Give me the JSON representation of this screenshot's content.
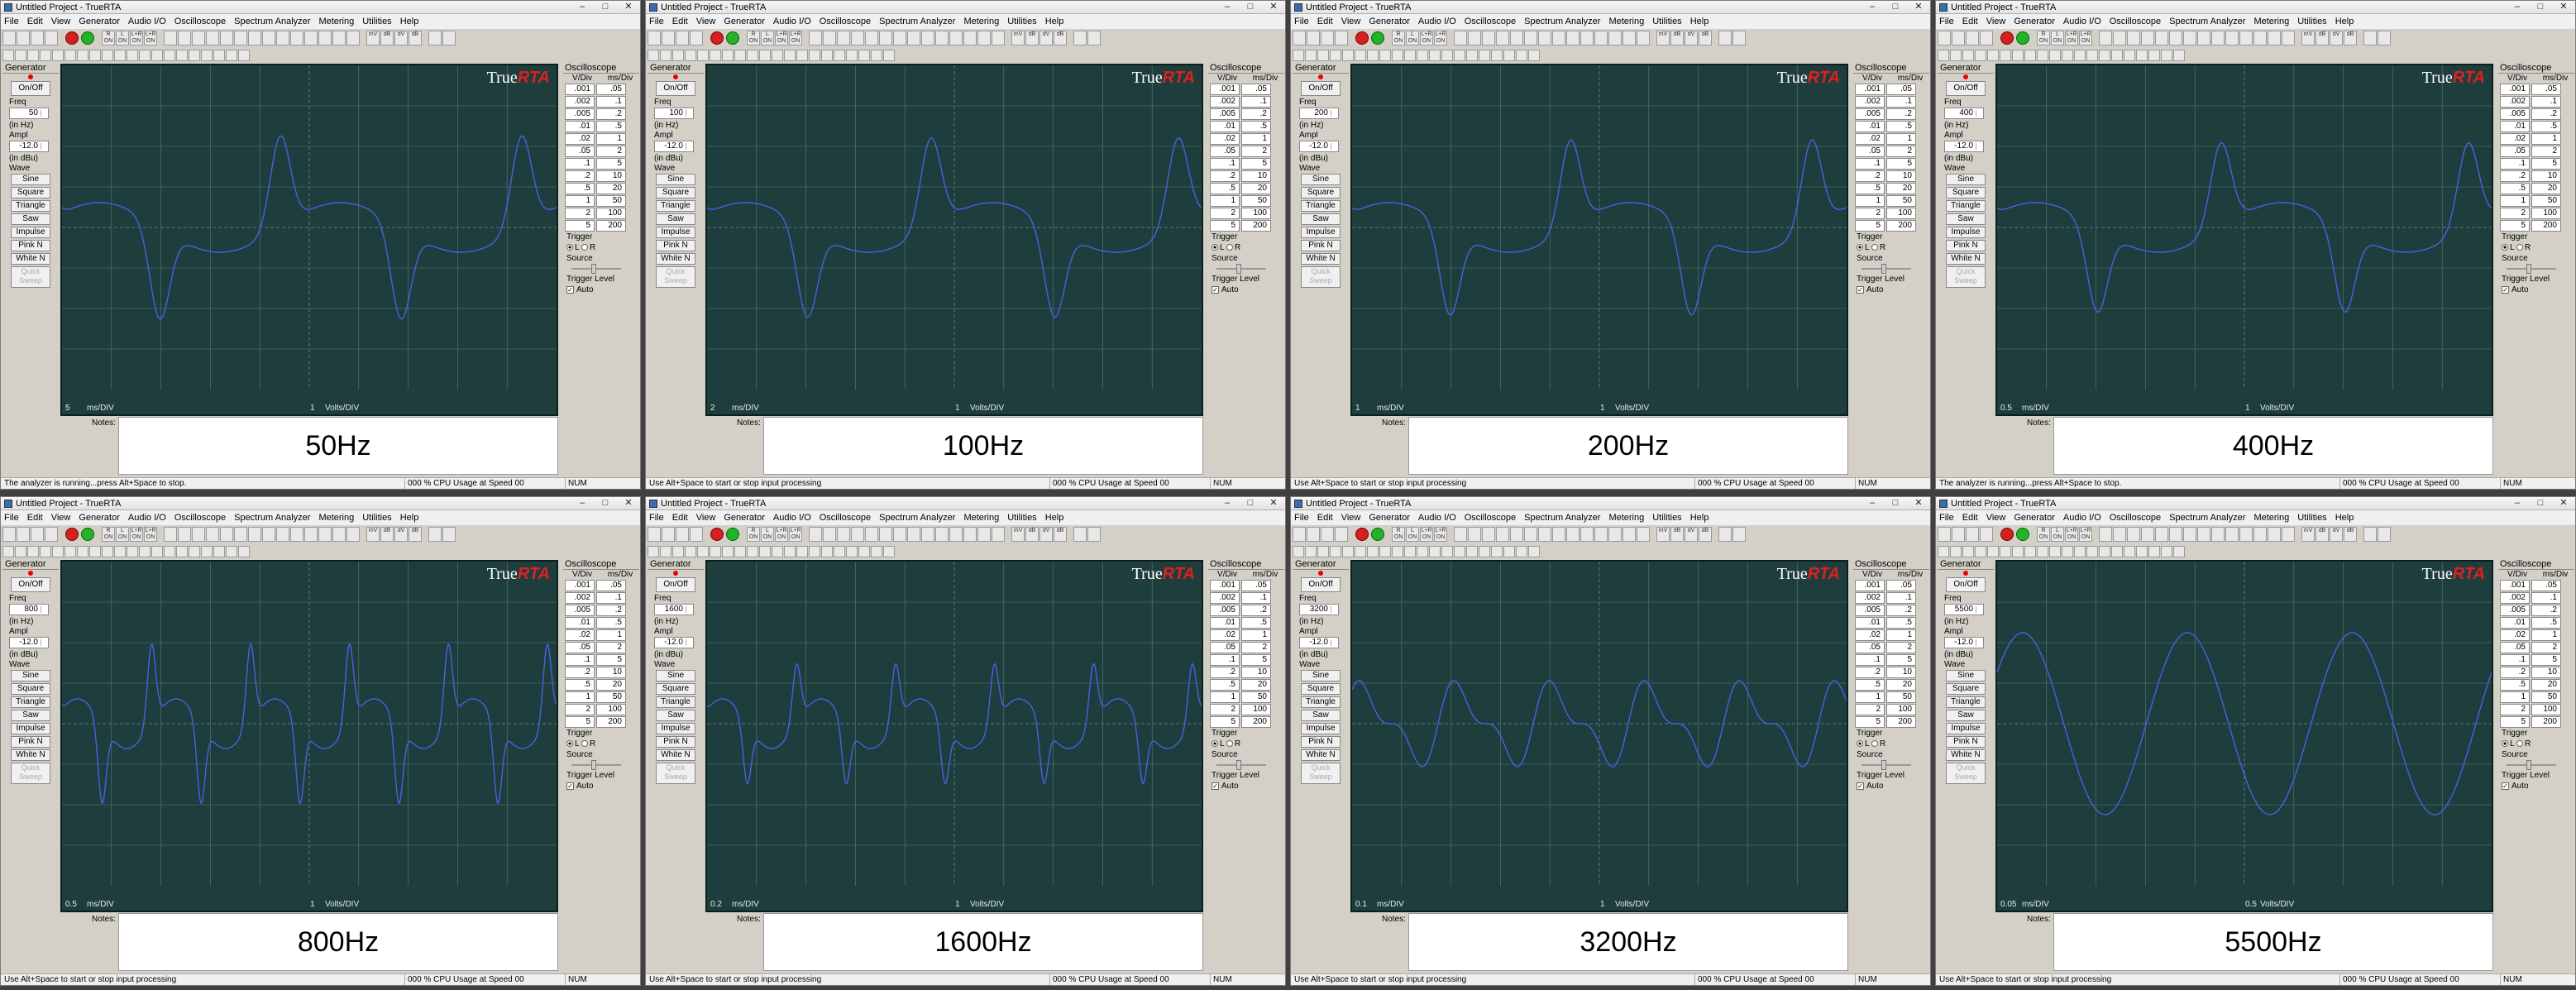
{
  "app": {
    "title": "Untitled Project - TrueRTA",
    "window_buttons": [
      "–",
      "□",
      "✕"
    ],
    "menu": [
      "File",
      "Edit",
      "View",
      "Generator",
      "Audio I/O",
      "Oscilloscope",
      "Spectrum Analyzer",
      "Metering",
      "Utilities",
      "Help"
    ],
    "toolbar_labels": [
      "R ON",
      "L ON",
      "L+R ON",
      "L+R ON",
      "mV",
      "dB",
      "dV",
      "dB"
    ],
    "brand_true": "True",
    "brand_rta": "RTA"
  },
  "generator": {
    "title": "Generator",
    "on_off": "On/Off",
    "freq_label": "Freq",
    "freq_unit": "(in Hz)",
    "ampl_label": "Ampl",
    "ampl_value": "-12.0",
    "ampl_unit": "(in dBu)",
    "wave_label": "Wave",
    "waves": [
      "Sine",
      "Square",
      "Triangle",
      "Saw",
      "Impulse",
      "Pink N",
      "White N"
    ],
    "quick_sweep": "Quick Sweep"
  },
  "oscilloscope": {
    "title": "Oscilloscope",
    "vdiv_header": "V/Div",
    "msdiv_header": "ms/Div",
    "vdiv": [
      ".001",
      ".002",
      ".005",
      ".01",
      ".02",
      ".05",
      ".1",
      ".2",
      ".5",
      "1",
      "2",
      "5"
    ],
    "msdiv": [
      ".05",
      ".1",
      ".2",
      ".5",
      "1",
      "2",
      "5",
      "10",
      "20",
      "50",
      "100",
      "200"
    ],
    "trigger": "Trigger",
    "left": "L",
    "right": "R",
    "source": "Source",
    "trigger_level": "Trigger Level",
    "auto": "Auto"
  },
  "labels": {
    "ms_div": "ms/DIV",
    "volts_div": "Volts/DIV",
    "notes": "Notes:",
    "num": "NUM"
  },
  "panels": [
    {
      "freq": "50",
      "ms_div_value": "5",
      "volts_div_value": "1",
      "note": "50Hz",
      "status": "The analyzer is running...press Alt+Space to stop.",
      "cpu": "000 % CPU Usage at Speed 00"
    },
    {
      "freq": "100",
      "ms_div_value": "2",
      "volts_div_value": "1",
      "note": "100Hz",
      "status": "Use Alt+Space to start or stop input processing",
      "cpu": "000 % CPU Usage at Speed 00"
    },
    {
      "freq": "200",
      "ms_div_value": "1",
      "volts_div_value": "1",
      "note": "200Hz",
      "status": "Use Alt+Space to start or stop input processing",
      "cpu": "000 % CPU Usage at Speed 00"
    },
    {
      "freq": "400",
      "ms_div_value": "0.5",
      "volts_div_value": "1",
      "note": "400Hz",
      "status": "The analyzer is running...press Alt+Space to stop.",
      "cpu": "000 % CPU Usage at Speed 00"
    },
    {
      "freq": "800",
      "ms_div_value": "0.5",
      "volts_div_value": "1",
      "note": "800Hz",
      "status": "Use Alt+Space to start or stop input processing",
      "cpu": "000 % CPU Usage at Speed 00"
    },
    {
      "freq": "1600",
      "ms_div_value": "0.2",
      "volts_div_value": "1",
      "note": "1600Hz",
      "status": "Use Alt+Space to start or stop input processing",
      "cpu": "000 % CPU Usage at Speed 00"
    },
    {
      "freq": "3200",
      "ms_div_value": "0.1",
      "volts_div_value": "1",
      "note": "3200Hz",
      "status": "Use Alt+Space to start or stop input processing",
      "cpu": "000 % CPU Usage at Speed 00"
    },
    {
      "freq": "5500",
      "ms_div_value": "0.05",
      "volts_div_value": "0.5",
      "note": "5500Hz",
      "status": "Use Alt+Space to start or stop input processing",
      "cpu": "000 % CPU Usage at Speed 00"
    }
  ],
  "colors": {
    "scope_bg": "#1d3e3d",
    "grid": "#5d7a78",
    "trace": "#4d5fe0"
  }
}
